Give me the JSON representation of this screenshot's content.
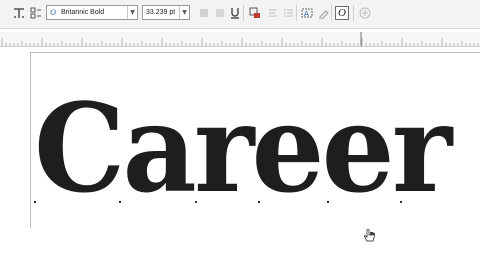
{
  "toolbar": {
    "font_name": "Britannic Bold",
    "font_size": "33.239 pt",
    "italic_button_glyph": "O"
  },
  "canvas": {
    "artistic_text": "Career"
  },
  "colors": {
    "text": "#1e1e1e",
    "toolbar_bg": "#f3f3f3",
    "ruler_bg": "#f6f6f6"
  }
}
